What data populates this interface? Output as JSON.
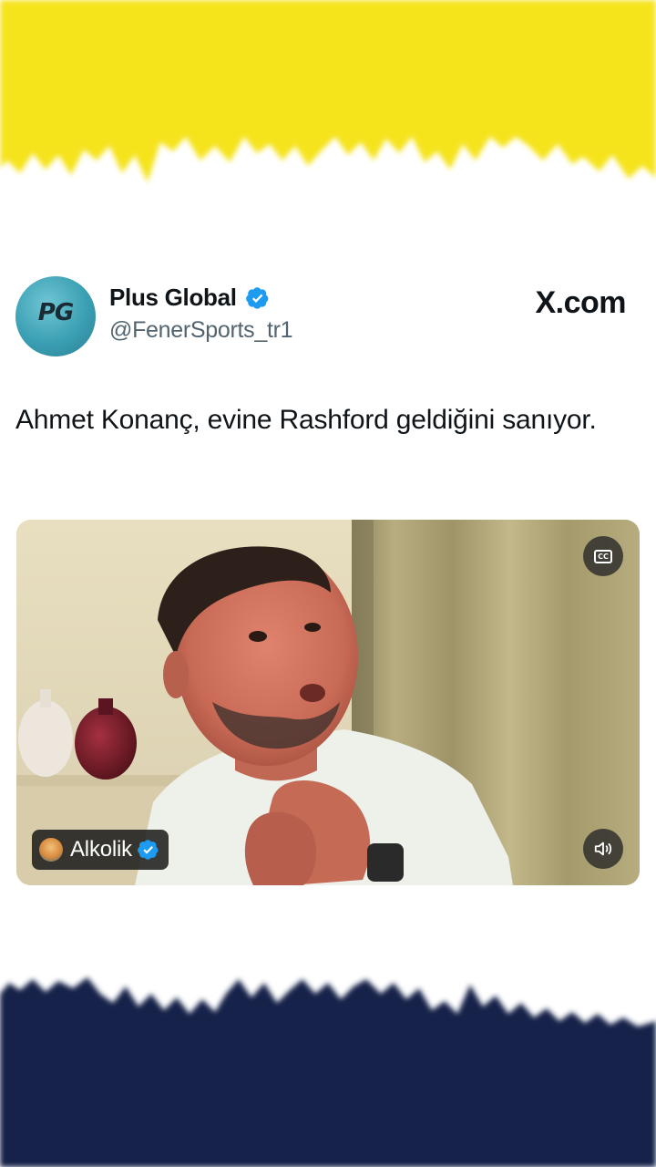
{
  "colors": {
    "top_band": "#f5e31a",
    "bottom_band": "#14244a",
    "verified_blue": "#1d9bf0",
    "handle_gray": "#536471"
  },
  "tweet": {
    "author_name": "Plus Global",
    "author_handle": "@FenerSports_tr1",
    "avatar_label": "PG",
    "source_brand": "X.com",
    "text": "Ahmet Konanç, evine Rashford geldiğini sanıyor.",
    "verified_icon": "verified-badge-icon"
  },
  "media": {
    "caption_button_label": "CC",
    "caption_icon": "closed-captions-icon",
    "volume_icon": "speaker-muted-icon",
    "tagged_user": "Alkolik",
    "tagged_user_verified": true
  }
}
